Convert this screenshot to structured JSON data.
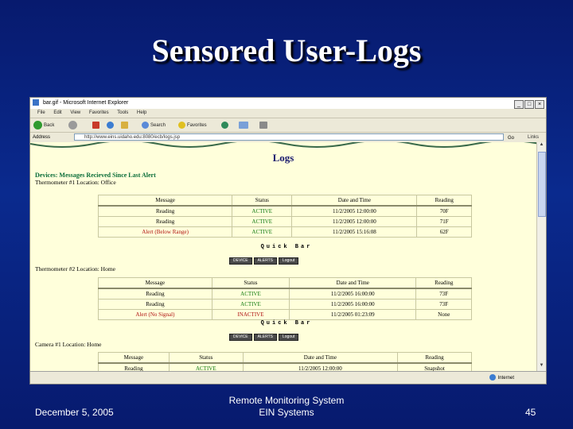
{
  "slide": {
    "title": "Sensored User-Logs",
    "footer_date": "December 5, 2005",
    "footer_line1": "Remote Monitoring System",
    "footer_line2": "EIN Systems",
    "page_number": "45"
  },
  "browser": {
    "window_title": "bar.gif - Microsoft Internet Explorer",
    "menu": [
      "File",
      "Edit",
      "View",
      "Favorites",
      "Tools",
      "Help"
    ],
    "toolbar": {
      "back": "Back",
      "search": "Search",
      "favorites": "Favorites"
    },
    "address_label": "Address",
    "address_value": "http://www.eins.uidaho.edu:8080/ecb/logs.jsp",
    "go_label": "Go",
    "links_label": "Links",
    "status_zone": "Internet"
  },
  "page": {
    "heading": "Logs",
    "alert_heading": "Devices: Messages Recieved Since Last Alert",
    "columns": [
      "Message",
      "Status",
      "Date and Time",
      "Reading"
    ],
    "quickbar_title": "Quick Bar",
    "quickbar_buttons": [
      "DEVICE",
      "ALERTS",
      "Logout"
    ],
    "sections": [
      {
        "header": "Thermometer #1 Location: Office",
        "rows": [
          {
            "message": "Reading",
            "status": "ACTIVE",
            "datetime": "11/2/2005 12:00:00",
            "reading": "70F"
          },
          {
            "message": "Reading",
            "status": "ACTIVE",
            "datetime": "11/2/2005 12:00:00",
            "reading": "71F"
          },
          {
            "message": "Alert (Below Range)",
            "status": "ACTIVE",
            "datetime": "11/2/2005 15:16:08",
            "reading": "62F"
          }
        ]
      },
      {
        "header": "Thermometer #2 Location: Home",
        "rows": [
          {
            "message": "Reading",
            "status": "ACTIVE",
            "datetime": "11/2/2005 16:00:00",
            "reading": "73F"
          },
          {
            "message": "Reading",
            "status": "ACTIVE",
            "datetime": "11/2/2005 16:00:00",
            "reading": "73F"
          },
          {
            "message": "Alert (No Signal)",
            "status": "INACTIVE",
            "datetime": "11/2/2005 01:23:09",
            "reading": "None"
          }
        ]
      },
      {
        "header": "Camera #1 Location: Home",
        "rows": [
          {
            "message": "Reading",
            "status": "ACTIVE",
            "datetime": "11/2/2005 12:00:00",
            "reading": "Snapshot"
          }
        ]
      }
    ]
  },
  "colors": {
    "slide_bg": "#0a2a8e",
    "page_bg": "#ffffdb",
    "active": "#117a11",
    "inactive": "#b01010",
    "heading": "#1a1a6e"
  },
  "icons": {
    "back": "back-arrow-icon",
    "forward": "forward-arrow-icon",
    "stop": "stop-icon",
    "refresh": "refresh-icon",
    "home": "home-icon",
    "search": "search-icon",
    "favorites": "favorites-star-icon",
    "media": "media-icon",
    "mail": "mail-icon",
    "print": "print-icon"
  }
}
